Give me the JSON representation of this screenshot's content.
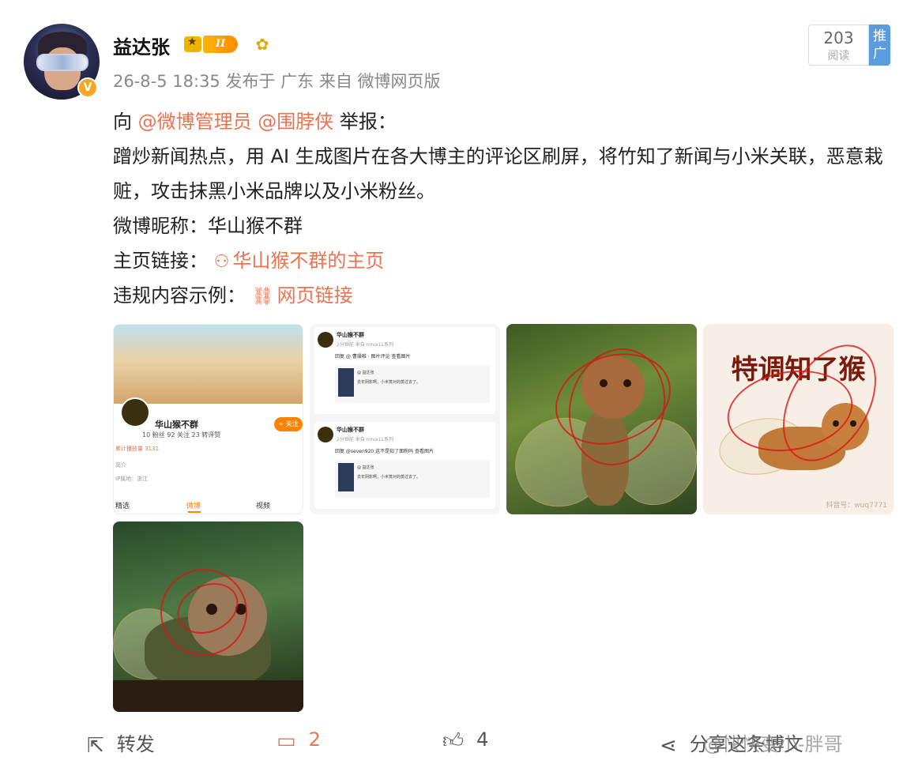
{
  "post": {
    "username": "益达张",
    "vip_level": "II",
    "meta": "26-8-5 18:35 发布于 广东 来自 微博网页版",
    "read_count": "203",
    "read_label": "阅读",
    "promote_label": "推广",
    "lines": {
      "l1_prefix": "向",
      "l1_mention1": "@微博管理员",
      "l1_mention2": "@围脖侠",
      "l1_suffix": "举报：",
      "l2": "蹭炒新闻热点，用 AI 生成图片在各大博主的评论区刷屏，将竹知了新闻与小米关联，恶意栽赃，攻击抹黑小米品牌以及小米粉丝。",
      "l4": "微博昵称：华山猴不群",
      "l5_label": "主页链接：",
      "l5_link": "华山猴不群的主页",
      "l6_label": "违规内容示例：",
      "l6_link": "网页链接"
    }
  },
  "images": {
    "img1": {
      "name": "华山猴不群",
      "stats": "10 粉丝   92 关注   23 转评赞",
      "follow": "+ 关注",
      "meta1": "累计播放量 3131",
      "meta2": "简介",
      "meta3": "IP属地：浙江",
      "tabs": [
        "精选",
        "微博",
        "视频"
      ]
    },
    "img2": {
      "c1_name": "华山猴不群",
      "c1_line": "2分钟前 来自 nova11系列",
      "c1_reply": "回复 @ 曹操唯 · 图片评论 查看图片",
      "c1_quote_title": "@ 益达张",
      "c1_quote_text": "去年阴影啊，小米蒸对的蒸过去了。",
      "c2_name": "华山猴不群",
      "c2_line": "2分钟前 来自 nova11系列",
      "c2_reply": "回复 @seven920 这不是知了面粉吗 查看图片",
      "c2_quote_title": "@ 益达张",
      "c2_quote_text": "去年阴影啊，小米蒸对的蒸过去了。"
    },
    "img4": {
      "title": "特调知了猴",
      "watermark": "抖音号：wuq7771"
    }
  },
  "actions": {
    "repost": "转发",
    "comments": "2",
    "likes": "4",
    "share_text": "分享这条博文"
  },
  "watermark": "@快快变小-胖哥",
  "colors": {
    "accent": "#eb7350",
    "promote": "#5b9bdf",
    "vip": "#ff8c00"
  }
}
